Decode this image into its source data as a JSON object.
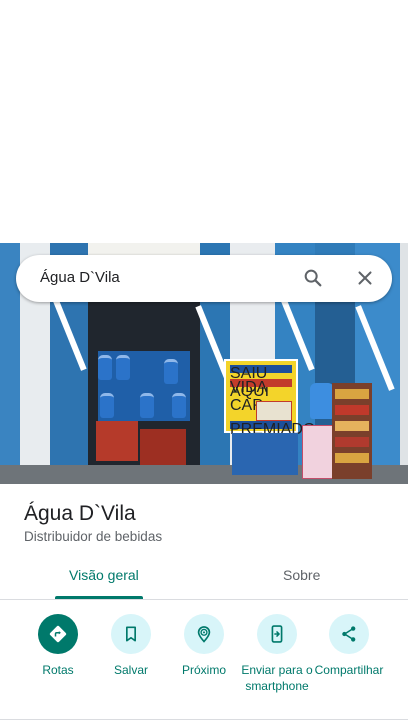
{
  "search": {
    "query": "Água D`Vila"
  },
  "photo": {
    "sign_line1": "SAIU AQUI",
    "sign_line2": "VIDA CAP",
    "sign_line3": "PREMIADO"
  },
  "place": {
    "name": "Água D`Vila",
    "category": "Distribuidor de bebidas"
  },
  "tabs": [
    {
      "label": "Visão geral",
      "active": true
    },
    {
      "label": "Sobre",
      "active": false
    }
  ],
  "actions": [
    {
      "label": "Rotas",
      "icon": "directions-icon"
    },
    {
      "label": "Salvar",
      "icon": "bookmark-icon"
    },
    {
      "label": "Próximo",
      "icon": "nearby-icon"
    },
    {
      "label": "Enviar para o smartphone",
      "icon": "send-to-phone-icon"
    },
    {
      "label": "Compartilhar",
      "icon": "share-icon"
    }
  ],
  "colors": {
    "accent": "#00796b",
    "action_bg": "#d8f5f9",
    "sign_yellow": "#f3d42a"
  }
}
